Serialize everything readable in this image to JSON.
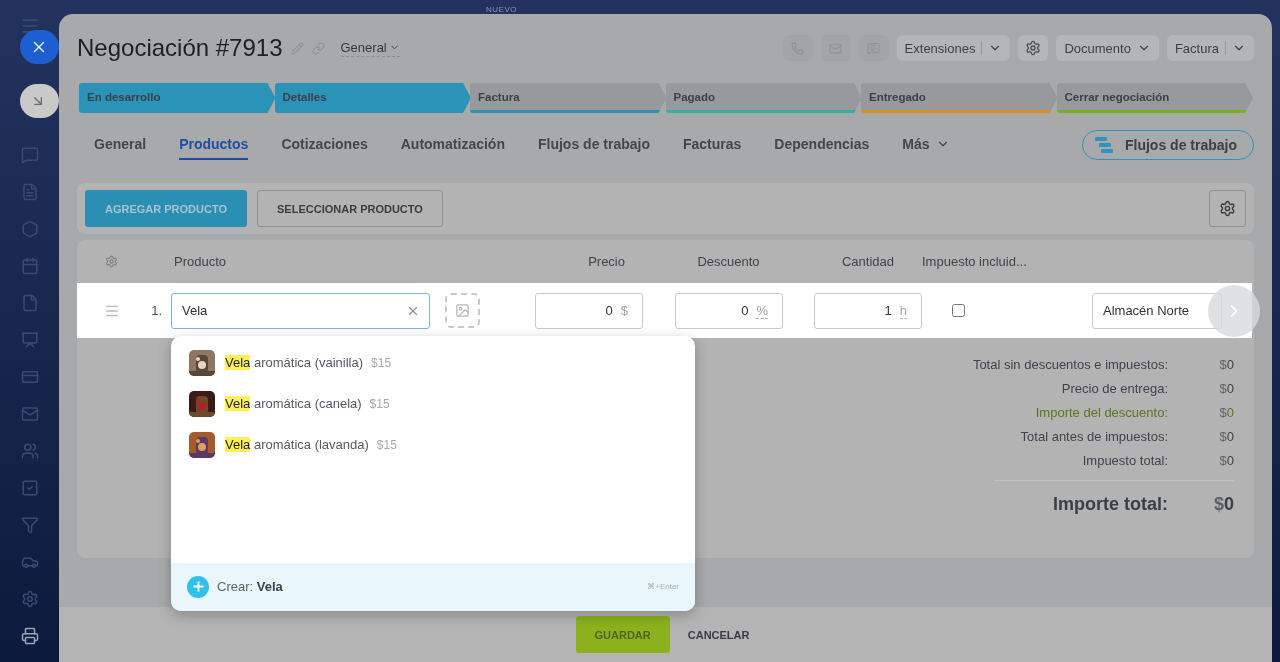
{
  "top_label": "NUEVO",
  "header": {
    "title": "Negociación #7913",
    "category": "General",
    "actions": [
      {
        "kind": "split",
        "label": "Extensiones"
      },
      {
        "kind": "gear"
      },
      {
        "kind": "dropdown",
        "label": "Documento"
      },
      {
        "kind": "split",
        "label": "Factura"
      }
    ]
  },
  "stages": [
    {
      "label": "En desarrollo",
      "color": "#2b93b8",
      "reached": true
    },
    {
      "label": "Detalles",
      "color": "#2b93b8",
      "reached": true
    },
    {
      "label": "Factura",
      "color": "#2b93b8",
      "reached": false
    },
    {
      "label": "Pagado",
      "color": "#2fb3a2",
      "reached": false
    },
    {
      "label": "Entregado",
      "color": "#e08b1c",
      "reached": false
    },
    {
      "label": "Cerrar negociación",
      "color": "#74b21a",
      "reached": false
    }
  ],
  "tabs": [
    {
      "label": "General",
      "selected": false,
      "kind": "link"
    },
    {
      "label": "Productos",
      "selected": true,
      "kind": "link"
    },
    {
      "label": "Cotizaciones",
      "selected": false,
      "kind": "link"
    },
    {
      "label": "Automatización",
      "selected": false,
      "kind": "link"
    },
    {
      "label": "Flujos de trabajo",
      "selected": false,
      "kind": "link"
    },
    {
      "label": "Facturas",
      "selected": false,
      "kind": "link"
    },
    {
      "label": "Dependencias",
      "selected": false,
      "kind": "link"
    },
    {
      "label": "Más",
      "selected": false,
      "kind": "menu"
    }
  ],
  "workflow_button": "Flujos de trabajo",
  "toolbar": {
    "add_button": "AGREGAR PRODUCTO",
    "select_button": "SELECCIONAR PRODUCTO"
  },
  "table": {
    "columns": [
      "Producto",
      "Precio",
      "Descuento",
      "Cantidad",
      "Impuesto incluid..."
    ],
    "row": {
      "number": "1.",
      "product": "Vela",
      "price": "0",
      "currency": "$",
      "discount": "0",
      "discount_unit": "%",
      "quantity": "1",
      "quantity_unit": "h",
      "tax_included": false,
      "warehouse": "Almacén Norte"
    }
  },
  "suggestions": [
    {
      "match": "Vela",
      "rest": "aromática (vainilla)",
      "price": "$15"
    },
    {
      "match": "Vela",
      "rest": "aromática (canela)",
      "price": "$15"
    },
    {
      "match": "Vela",
      "rest": "aromática (lavanda)",
      "price": "$15"
    }
  ],
  "create": {
    "label": "Crear: **Vela**",
    "shortcut": "⌘+Enter"
  },
  "totals": [
    {
      "label": "Total sin descuentos e impuestos:",
      "currency": "$",
      "value": "0",
      "color": "#3f444c"
    },
    {
      "label": "Precio de entrega:",
      "currency": "$",
      "value": "0",
      "color": "#3f444c"
    },
    {
      "label": "Importe del descuento:",
      "currency": "$",
      "value": "0",
      "color": "#5d7420"
    },
    {
      "label": "Total antes de impuestos:",
      "currency": "$",
      "value": "0",
      "color": "#3f444c"
    },
    {
      "label": "Impuesto total:",
      "currency": "$",
      "value": "0",
      "color": "#3f444c"
    }
  ],
  "grand_total": {
    "label": "Importe total:",
    "currency": "$",
    "value": "0"
  },
  "footer": {
    "save": "GUARDAR",
    "cancel": "CANCELAR"
  }
}
